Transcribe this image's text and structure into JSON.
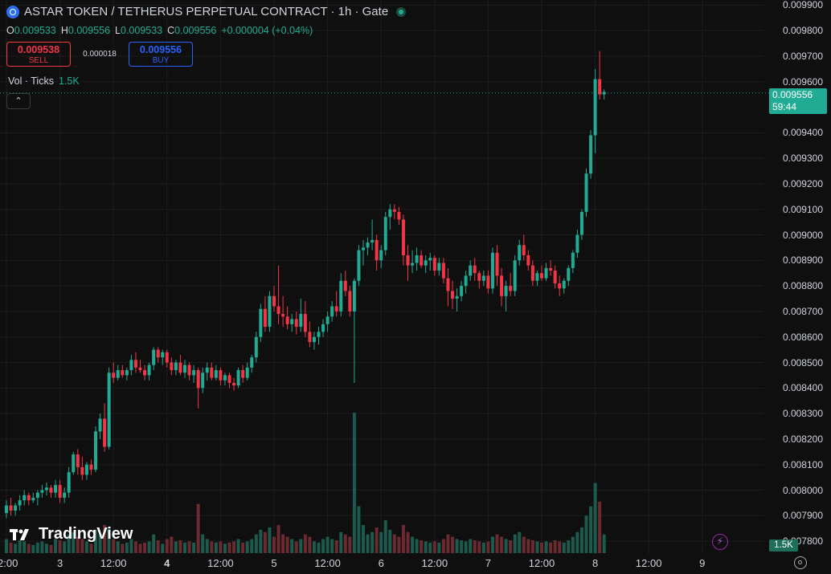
{
  "header": {
    "title": "ASTAR TOKEN / TETHERUS PERPETUAL CONTRACT · 1h · Gate",
    "ohlc": {
      "o_label": "O",
      "o": "0.009533",
      "h_label": "H",
      "h": "0.009556",
      "l_label": "L",
      "l": "0.009533",
      "c_label": "C",
      "c": "0.009556",
      "change": "+0.000004 (+0.04%)"
    }
  },
  "trade": {
    "sell_price": "0.009538",
    "sell_label": "SELL",
    "spread": "0.000018",
    "buy_price": "0.009556",
    "buy_label": "BUY"
  },
  "volume": {
    "label": "Vol · Ticks",
    "value": "1.5K",
    "axis_tag": "1.5K"
  },
  "current": {
    "price": "0.009556",
    "countdown": "59:44"
  },
  "branding": {
    "logo_text": "TradingView"
  },
  "colors": {
    "up": "#22ab94",
    "down": "#f23645",
    "background": "#0f0f0f"
  },
  "chart_data": {
    "type": "candlestick",
    "ylim": [
      0.00775,
      0.00992
    ],
    "y_ticks": [
      "0.009900",
      "0.009800",
      "0.009700",
      "0.009600",
      "0.009400",
      "0.009300",
      "0.009200",
      "0.009100",
      "0.009000",
      "0.008900",
      "0.008800",
      "0.008700",
      "0.008600",
      "0.008500",
      "0.008400",
      "0.008300",
      "0.008200",
      "0.008100",
      "0.008000",
      "0.007900",
      "0.007800"
    ],
    "x_ticks": [
      {
        "label": "2:00",
        "bold": false,
        "idx": 0
      },
      {
        "label": "3",
        "bold": false,
        "idx": 12
      },
      {
        "label": "12:00",
        "bold": false,
        "idx": 24
      },
      {
        "label": "4",
        "bold": true,
        "idx": 36
      },
      {
        "label": "12:00",
        "bold": false,
        "idx": 48
      },
      {
        "label": "5",
        "bold": false,
        "idx": 60
      },
      {
        "label": "12:00",
        "bold": false,
        "idx": 72
      },
      {
        "label": "6",
        "bold": false,
        "idx": 84
      },
      {
        "label": "12:00",
        "bold": false,
        "idx": 96
      },
      {
        "label": "7",
        "bold": false,
        "idx": 108
      },
      {
        "label": "12:00",
        "bold": false,
        "idx": 120
      },
      {
        "label": "8",
        "bold": false,
        "idx": 132
      },
      {
        "label": "12:00",
        "bold": false,
        "idx": 144
      },
      {
        "label": "9",
        "bold": false,
        "idx": 156
      }
    ],
    "candles": [
      [
        0.00791,
        0.00796,
        0.00789,
        0.00794,
        60
      ],
      [
        0.00794,
        0.00797,
        0.0079,
        0.00792,
        45
      ],
      [
        0.00792,
        0.00795,
        0.0079,
        0.00794,
        40
      ],
      [
        0.00794,
        0.00798,
        0.00792,
        0.00796,
        55
      ],
      [
        0.00796,
        0.008,
        0.00794,
        0.00798,
        50
      ],
      [
        0.00798,
        0.00799,
        0.00794,
        0.00796,
        40
      ],
      [
        0.00796,
        0.00799,
        0.00795,
        0.00797,
        35
      ],
      [
        0.00797,
        0.008,
        0.00794,
        0.00799,
        45
      ],
      [
        0.00799,
        0.00802,
        0.00797,
        0.008,
        50
      ],
      [
        0.008,
        0.00803,
        0.00798,
        0.00801,
        40
      ],
      [
        0.00801,
        0.00802,
        0.00797,
        0.00799,
        35
      ],
      [
        0.00799,
        0.00804,
        0.00797,
        0.00802,
        60
      ],
      [
        0.00802,
        0.00804,
        0.00795,
        0.00797,
        55
      ],
      [
        0.00797,
        0.00801,
        0.00795,
        0.00799,
        50
      ],
      [
        0.00799,
        0.00809,
        0.00797,
        0.00807,
        80
      ],
      [
        0.00807,
        0.00815,
        0.00806,
        0.00814,
        90
      ],
      [
        0.00814,
        0.00816,
        0.00806,
        0.00809,
        70
      ],
      [
        0.00809,
        0.00813,
        0.00804,
        0.00806,
        60
      ],
      [
        0.00806,
        0.00811,
        0.00804,
        0.0081,
        50
      ],
      [
        0.0081,
        0.00812,
        0.00806,
        0.00808,
        40
      ],
      [
        0.00808,
        0.00825,
        0.00807,
        0.00823,
        100
      ],
      [
        0.00823,
        0.0083,
        0.0082,
        0.00828,
        80
      ],
      [
        0.00828,
        0.00834,
        0.00815,
        0.00817,
        120
      ],
      [
        0.00817,
        0.00848,
        0.00816,
        0.00846,
        110
      ],
      [
        0.00846,
        0.0085,
        0.00842,
        0.00844,
        60
      ],
      [
        0.00844,
        0.00849,
        0.00843,
        0.00847,
        50
      ],
      [
        0.00847,
        0.00849,
        0.00844,
        0.00845,
        40
      ],
      [
        0.00845,
        0.00848,
        0.00843,
        0.00847,
        45
      ],
      [
        0.00847,
        0.00853,
        0.00845,
        0.00851,
        60
      ],
      [
        0.00851,
        0.00854,
        0.00846,
        0.00848,
        50
      ],
      [
        0.00848,
        0.00851,
        0.00846,
        0.00847,
        40
      ],
      [
        0.00847,
        0.00849,
        0.00843,
        0.00845,
        45
      ],
      [
        0.00845,
        0.0085,
        0.00843,
        0.00849,
        50
      ],
      [
        0.00849,
        0.00856,
        0.00847,
        0.00855,
        80
      ],
      [
        0.00855,
        0.00856,
        0.0085,
        0.00852,
        55
      ],
      [
        0.00852,
        0.00855,
        0.00849,
        0.00854,
        40
      ],
      [
        0.00854,
        0.00855,
        0.00848,
        0.0085,
        60
      ],
      [
        0.0085,
        0.00852,
        0.00845,
        0.00847,
        70
      ],
      [
        0.00847,
        0.00851,
        0.00845,
        0.0085,
        50
      ],
      [
        0.0085,
        0.00853,
        0.00845,
        0.00846,
        55
      ],
      [
        0.00846,
        0.00851,
        0.00844,
        0.00849,
        45
      ],
      [
        0.00849,
        0.0085,
        0.00843,
        0.00845,
        50
      ],
      [
        0.00845,
        0.00849,
        0.00842,
        0.00847,
        45
      ],
      [
        0.00847,
        0.00848,
        0.00832,
        0.0084,
        210
      ],
      [
        0.0084,
        0.00848,
        0.00838,
        0.00846,
        80
      ],
      [
        0.00846,
        0.0085,
        0.00843,
        0.00848,
        60
      ],
      [
        0.00848,
        0.0085,
        0.00843,
        0.00844,
        50
      ],
      [
        0.00844,
        0.00849,
        0.00843,
        0.00847,
        45
      ],
      [
        0.00847,
        0.00848,
        0.00841,
        0.00843,
        50
      ],
      [
        0.00843,
        0.00846,
        0.00841,
        0.00845,
        40
      ],
      [
        0.00845,
        0.00846,
        0.0084,
        0.00842,
        45
      ],
      [
        0.00842,
        0.00844,
        0.00839,
        0.00841,
        50
      ],
      [
        0.00841,
        0.00848,
        0.0084,
        0.00847,
        60
      ],
      [
        0.00847,
        0.00849,
        0.00842,
        0.00844,
        45
      ],
      [
        0.00844,
        0.0085,
        0.00843,
        0.00848,
        50
      ],
      [
        0.00848,
        0.00853,
        0.00846,
        0.00852,
        60
      ],
      [
        0.00852,
        0.00862,
        0.0085,
        0.0086,
        80
      ],
      [
        0.0086,
        0.00873,
        0.00858,
        0.00871,
        100
      ],
      [
        0.00871,
        0.00876,
        0.00862,
        0.00864,
        90
      ],
      [
        0.00864,
        0.00878,
        0.00862,
        0.00876,
        110
      ],
      [
        0.00876,
        0.0088,
        0.0087,
        0.00872,
        70
      ],
      [
        0.00872,
        0.00888,
        0.00865,
        0.00869,
        120
      ],
      [
        0.00869,
        0.00876,
        0.00864,
        0.00868,
        80
      ],
      [
        0.00868,
        0.00872,
        0.00863,
        0.00865,
        70
      ],
      [
        0.00865,
        0.00869,
        0.00862,
        0.00867,
        60
      ],
      [
        0.00867,
        0.0087,
        0.00861,
        0.00864,
        50
      ],
      [
        0.00864,
        0.00875,
        0.00862,
        0.00869,
        60
      ],
      [
        0.00869,
        0.00874,
        0.0086,
        0.00862,
        80
      ],
      [
        0.00862,
        0.00866,
        0.00856,
        0.00858,
        70
      ],
      [
        0.00858,
        0.00862,
        0.00855,
        0.0086,
        50
      ],
      [
        0.0086,
        0.00864,
        0.00857,
        0.00862,
        45
      ],
      [
        0.00862,
        0.00867,
        0.0086,
        0.00865,
        60
      ],
      [
        0.00865,
        0.0087,
        0.00862,
        0.00868,
        70
      ],
      [
        0.00868,
        0.00874,
        0.00866,
        0.00872,
        60
      ],
      [
        0.00872,
        0.00878,
        0.00868,
        0.0087,
        55
      ],
      [
        0.0087,
        0.00885,
        0.00868,
        0.00882,
        90
      ],
      [
        0.00882,
        0.00886,
        0.00876,
        0.00878,
        80
      ],
      [
        0.00878,
        0.0088,
        0.00868,
        0.0087,
        70
      ],
      [
        0.0087,
        0.00883,
        0.00842,
        0.00882,
        600
      ],
      [
        0.00882,
        0.00896,
        0.0088,
        0.00894,
        200
      ],
      [
        0.00894,
        0.00898,
        0.00888,
        0.00895,
        120
      ],
      [
        0.00895,
        0.00899,
        0.00892,
        0.00897,
        80
      ],
      [
        0.00897,
        0.00906,
        0.00894,
        0.00898,
        90
      ],
      [
        0.00898,
        0.009,
        0.00886,
        0.0089,
        110
      ],
      [
        0.0089,
        0.00896,
        0.00887,
        0.00894,
        90
      ],
      [
        0.00894,
        0.00909,
        0.00892,
        0.00907,
        140
      ],
      [
        0.00907,
        0.00912,
        0.00902,
        0.0091,
        100
      ],
      [
        0.0091,
        0.00912,
        0.00906,
        0.00909,
        80
      ],
      [
        0.00909,
        0.00911,
        0.00904,
        0.00906,
        70
      ],
      [
        0.00906,
        0.00908,
        0.00888,
        0.00892,
        120
      ],
      [
        0.00892,
        0.00896,
        0.00882,
        0.00888,
        90
      ],
      [
        0.00888,
        0.00894,
        0.00885,
        0.00889,
        70
      ],
      [
        0.00889,
        0.00895,
        0.00886,
        0.00892,
        60
      ],
      [
        0.00892,
        0.00894,
        0.00887,
        0.00888,
        55
      ],
      [
        0.00888,
        0.00892,
        0.00885,
        0.0089,
        50
      ],
      [
        0.0089,
        0.00893,
        0.00886,
        0.00891,
        45
      ],
      [
        0.00891,
        0.00892,
        0.00884,
        0.00886,
        50
      ],
      [
        0.00886,
        0.00891,
        0.00884,
        0.00889,
        45
      ],
      [
        0.00889,
        0.00891,
        0.00881,
        0.00883,
        60
      ],
      [
        0.00883,
        0.00887,
        0.00872,
        0.00878,
        80
      ],
      [
        0.00878,
        0.00882,
        0.00871,
        0.00875,
        70
      ],
      [
        0.00875,
        0.00879,
        0.0087,
        0.00876,
        60
      ],
      [
        0.00876,
        0.00882,
        0.00874,
        0.0088,
        55
      ],
      [
        0.0088,
        0.00886,
        0.00877,
        0.00884,
        50
      ],
      [
        0.00884,
        0.0089,
        0.00882,
        0.00888,
        60
      ],
      [
        0.00888,
        0.00891,
        0.00882,
        0.00885,
        55
      ],
      [
        0.00885,
        0.00886,
        0.00879,
        0.00882,
        50
      ],
      [
        0.00882,
        0.00886,
        0.0088,
        0.00884,
        45
      ],
      [
        0.00884,
        0.00886,
        0.00877,
        0.00879,
        50
      ],
      [
        0.00879,
        0.00895,
        0.00877,
        0.00893,
        70
      ],
      [
        0.00893,
        0.00896,
        0.0088,
        0.00884,
        80
      ],
      [
        0.00884,
        0.00887,
        0.00872,
        0.00876,
        70
      ],
      [
        0.00876,
        0.00882,
        0.0087,
        0.0088,
        60
      ],
      [
        0.0088,
        0.00885,
        0.00876,
        0.00878,
        55
      ],
      [
        0.00878,
        0.00892,
        0.00876,
        0.0089,
        80
      ],
      [
        0.0089,
        0.00898,
        0.00888,
        0.00896,
        90
      ],
      [
        0.00896,
        0.009,
        0.0089,
        0.00892,
        70
      ],
      [
        0.00892,
        0.00894,
        0.00886,
        0.00888,
        60
      ],
      [
        0.00888,
        0.0089,
        0.0088,
        0.00882,
        55
      ],
      [
        0.00882,
        0.00886,
        0.0088,
        0.00885,
        50
      ],
      [
        0.00885,
        0.00888,
        0.00882,
        0.00883,
        45
      ],
      [
        0.00883,
        0.00889,
        0.00882,
        0.00887,
        50
      ],
      [
        0.00887,
        0.0089,
        0.00884,
        0.00886,
        45
      ],
      [
        0.00886,
        0.00888,
        0.00879,
        0.00881,
        55
      ],
      [
        0.00881,
        0.00884,
        0.00876,
        0.00879,
        50
      ],
      [
        0.00879,
        0.00883,
        0.00877,
        0.00882,
        45
      ],
      [
        0.00882,
        0.00888,
        0.0088,
        0.00887,
        55
      ],
      [
        0.00887,
        0.00894,
        0.00885,
        0.00893,
        70
      ],
      [
        0.00893,
        0.00902,
        0.00891,
        0.009,
        90
      ],
      [
        0.009,
        0.0091,
        0.00898,
        0.00909,
        110
      ],
      [
        0.00909,
        0.00926,
        0.00907,
        0.00924,
        160
      ],
      [
        0.00924,
        0.00941,
        0.00922,
        0.00939,
        200
      ],
      [
        0.00939,
        0.00965,
        0.00932,
        0.00961,
        300
      ],
      [
        0.00961,
        0.00972,
        0.00953,
        0.00955,
        220
      ],
      [
        0.00955,
        0.00957,
        0.00953,
        0.00956,
        80
      ]
    ]
  }
}
